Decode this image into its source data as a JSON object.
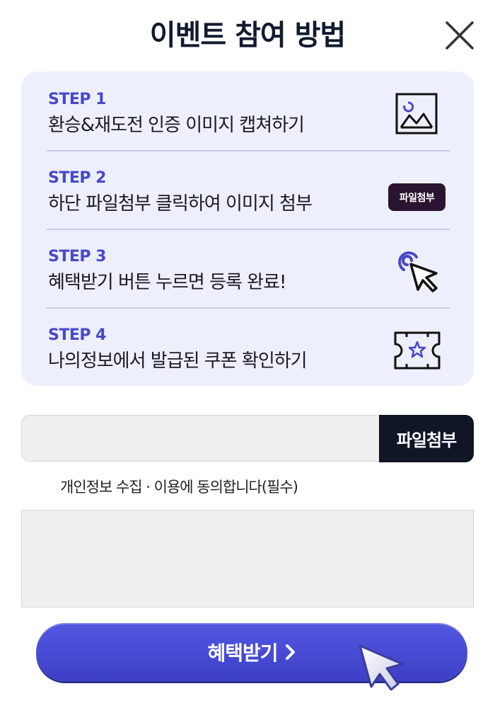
{
  "header": {
    "title": "이벤트 참여 방법"
  },
  "steps": [
    {
      "label": "STEP 1",
      "text": "환승&재도전 인증 이미지 캡쳐하기",
      "icon": "image-capture-icon"
    },
    {
      "label": "STEP 2",
      "text": "하단 파일첨부 클릭하여 이미지 첨부",
      "icon": "file-attach-chip",
      "chip_label": "파일첨부"
    },
    {
      "label": "STEP 3",
      "text": "혜택받기 버튼 누르면 등록 완료!",
      "icon": "click-cursor-icon"
    },
    {
      "label": "STEP 4",
      "text": "나의정보에서 발급된 쿠폰 확인하기",
      "icon": "coupon-star-icon"
    }
  ],
  "upload": {
    "button_label": "파일첨부",
    "value": ""
  },
  "consent": {
    "text": "개인정보 수집 · 이용에 동의합니다(필수)"
  },
  "cta": {
    "label": "혜택받기"
  },
  "colors": {
    "accent": "#4649c8",
    "dark": "#101626",
    "panel": "#eeeffc"
  }
}
